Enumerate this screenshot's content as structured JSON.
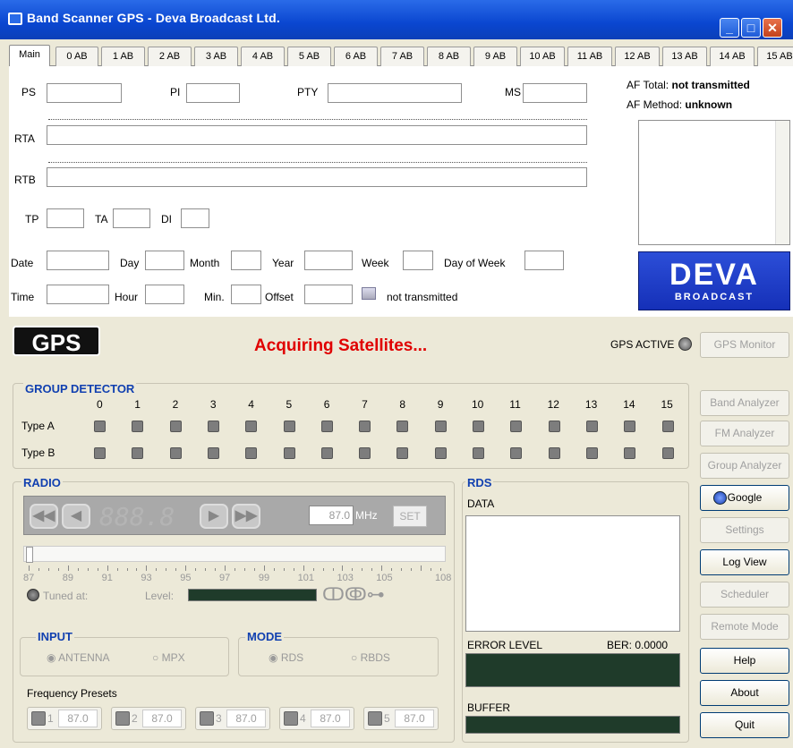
{
  "window": {
    "title": "Band Scanner GPS - Deva Broadcast Ltd.",
    "min_icon": "minimize-icon",
    "max_icon": "maximize-icon",
    "close_icon": "close-icon"
  },
  "tabs": [
    "Main",
    "0 AB",
    "1 AB",
    "2 AB",
    "3 AB",
    "4 AB",
    "5 AB",
    "6 AB",
    "7 AB",
    "8 AB",
    "9 AB",
    "10 AB",
    "11 AB",
    "12 AB",
    "13 AB",
    "14 AB",
    "15 AB"
  ],
  "main": {
    "ps": "PS",
    "pi": "PI",
    "pty": "PTY",
    "ms": "MS",
    "rta": "RTA",
    "rtb": "RTB",
    "tp": "TP",
    "ta": "TA",
    "di": "DI",
    "date": "Date",
    "day": "Day",
    "month": "Month",
    "year": "Year",
    "week": "Week",
    "day_of_week": "Day of Week",
    "time": "Time",
    "hour": "Hour",
    "min": "Min.",
    "offset": "Offset",
    "time_status": "not transmitted",
    "af_total_label": "AF Total:",
    "af_total_value": "not transmitted",
    "af_method_label": "AF Method:",
    "af_method_value": "unknown",
    "logo_main": "DEVA",
    "logo_sub": "BROADCAST"
  },
  "gps": {
    "logo": "GPS",
    "status": "Acquiring Satellites...",
    "active_label": "GPS ACTIVE",
    "monitor_button": "GPS Monitor"
  },
  "group_detector": {
    "title": "GROUP DETECTOR",
    "columns": [
      "0",
      "1",
      "2",
      "3",
      "4",
      "5",
      "6",
      "7",
      "8",
      "9",
      "10",
      "11",
      "12",
      "13",
      "14",
      "15"
    ],
    "rows": [
      "Type A",
      "Type B"
    ]
  },
  "radio": {
    "title": "RADIO",
    "display": "888.8",
    "freq": "87.0",
    "unit": "MHz",
    "set": "SET",
    "scale": [
      "87",
      "89",
      "91",
      "93",
      "95",
      "97",
      "99",
      "101",
      "103",
      "105",
      "108"
    ],
    "tuned_at": "Tuned at:",
    "level": "Level:"
  },
  "input": {
    "title": "INPUT",
    "options": [
      "ANTENNA",
      "MPX"
    ]
  },
  "mode": {
    "title": "MODE",
    "options": [
      "RDS",
      "RBDS"
    ]
  },
  "presets": {
    "title": "Frequency Presets",
    "items": [
      {
        "n": "1",
        "f": "87.0"
      },
      {
        "n": "2",
        "f": "87.0"
      },
      {
        "n": "3",
        "f": "87.0"
      },
      {
        "n": "4",
        "f": "87.0"
      },
      {
        "n": "5",
        "f": "87.0"
      }
    ]
  },
  "rds": {
    "title": "RDS",
    "data": "DATA",
    "error_level": "ERROR LEVEL",
    "ber": "BER: 0.0000",
    "buffer": "BUFFER"
  },
  "side_buttons": [
    {
      "label": "Band Analyzer",
      "enabled": false
    },
    {
      "label": "FM Analyzer",
      "enabled": false
    },
    {
      "label": "Group Analyzer",
      "enabled": false
    },
    {
      "label": "Google",
      "enabled": true
    },
    {
      "label": "Settings",
      "enabled": false
    },
    {
      "label": "Log View",
      "enabled": true
    },
    {
      "label": "Scheduler",
      "enabled": false
    },
    {
      "label": "Remote Mode",
      "enabled": false
    },
    {
      "label": "Help",
      "enabled": true
    },
    {
      "label": "About",
      "enabled": true
    },
    {
      "label": "Quit",
      "enabled": true
    }
  ],
  "colors": {
    "title_bar": "#0a46d0",
    "status_red": "#e00000",
    "group_title": "#1140b0",
    "deva_blue": "#1f3fd0"
  }
}
